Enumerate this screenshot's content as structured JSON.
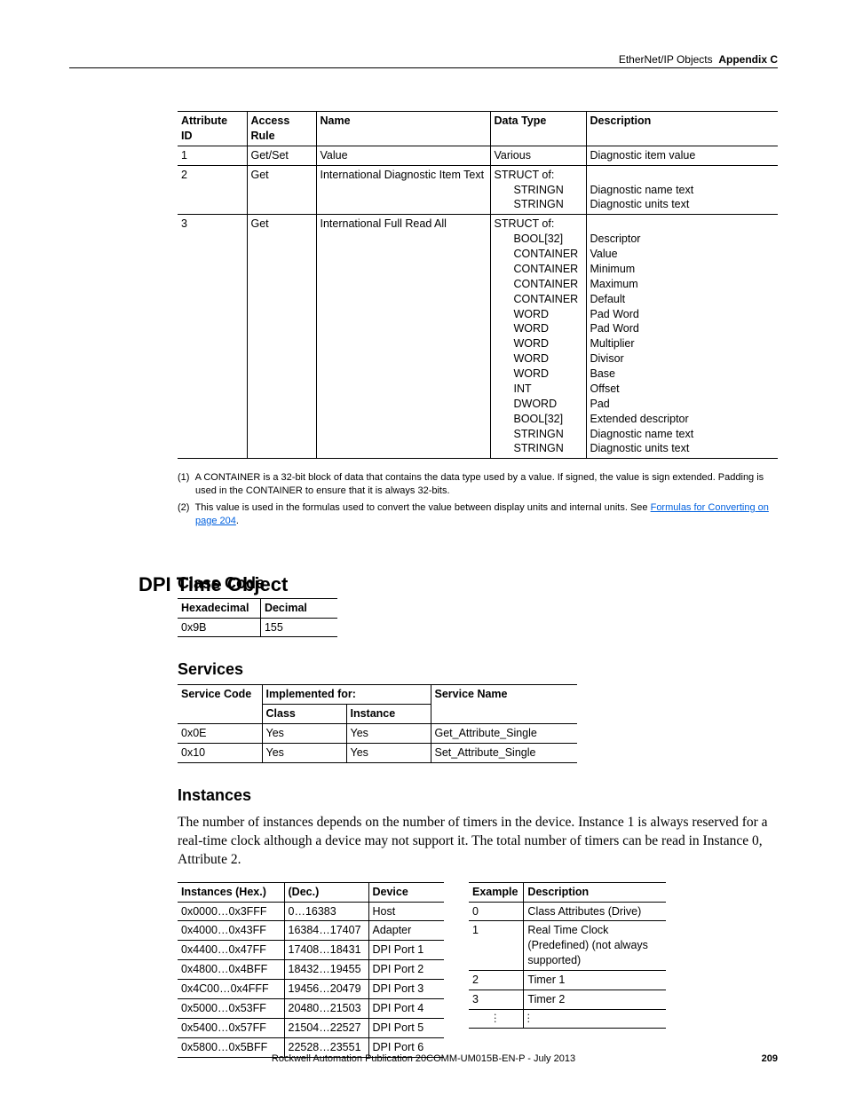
{
  "header": {
    "left": "EtherNet/IP Objects",
    "right": "Appendix C"
  },
  "table1": {
    "headers": [
      "Attribute ID",
      "Access Rule",
      "Name",
      "Data Type",
      "Description"
    ],
    "rows": [
      {
        "id": "1",
        "access": "Get/Set",
        "name": "Value",
        "dtype": "Various",
        "desc": "Diagnostic item value"
      },
      {
        "id": "2",
        "access": "Get",
        "name": "International Diagnostic Item Text",
        "dtype_lines": [
          "STRUCT of:",
          "STRINGN",
          "STRINGN"
        ],
        "desc_lines": [
          "",
          "Diagnostic name text",
          "Diagnostic units text"
        ]
      },
      {
        "id": "3",
        "access": "Get",
        "name": "International Full Read All",
        "dtype_lines": [
          "STRUCT of:",
          "BOOL[32]",
          "CONTAINER",
          "CONTAINER",
          "CONTAINER",
          "CONTAINER",
          "WORD",
          "WORD",
          "WORD",
          "WORD",
          "WORD",
          "INT",
          "DWORD",
          "BOOL[32]",
          "STRINGN",
          "STRINGN"
        ],
        "desc_lines": [
          "",
          "Descriptor",
          "Value",
          "Minimum",
          "Maximum",
          "Default",
          "Pad Word",
          "Pad Word",
          "Multiplier",
          "Divisor",
          "Base",
          "Offset",
          "Pad",
          "Extended descriptor",
          "Diagnostic name text",
          "Diagnostic units text"
        ]
      }
    ]
  },
  "footnotes": {
    "n1": "A CONTAINER is a 32-bit block of data that contains the data type used by a value. If signed, the value is sign extended. Padding is used in the CONTAINER to ensure that it is always 32-bits.",
    "n2_a": "This value is used in the formulas used to convert the value between display units and internal units. See ",
    "n2_link": "Formulas for Converting on page 204",
    "n2_b": "."
  },
  "section": {
    "title": "DPI Time Object"
  },
  "classcode": {
    "title": "Class Code",
    "headers": [
      "Hexadecimal",
      "Decimal"
    ],
    "row": [
      "0x9B",
      "155"
    ]
  },
  "services": {
    "title": "Services",
    "headers": {
      "code": "Service Code",
      "impl": "Implemented for:",
      "name": "Service Name",
      "class": "Class",
      "instance": "Instance"
    },
    "rows": [
      {
        "code": "0x0E",
        "class": "Yes",
        "instance": "Yes",
        "name": "Get_Attribute_Single"
      },
      {
        "code": "0x10",
        "class": "Yes",
        "instance": "Yes",
        "name": "Set_Attribute_Single"
      }
    ]
  },
  "instances": {
    "title": "Instances",
    "intro": "The number of instances depends on the number of timers in the device. Instance 1 is always reserved for a real-time clock although a device may not support it. The total number of timers can be read in Instance 0, Attribute 2.",
    "left": {
      "headers": [
        "Instances (Hex.)",
        "(Dec.)",
        "Device"
      ],
      "rows": [
        [
          "0x0000…0x3FFF",
          "0…16383",
          "Host"
        ],
        [
          "0x4000…0x43FF",
          "16384…17407",
          "Adapter"
        ],
        [
          "0x4400…0x47FF",
          "17408…18431",
          "DPI Port 1"
        ],
        [
          "0x4800…0x4BFF",
          "18432…19455",
          "DPI Port 2"
        ],
        [
          "0x4C00…0x4FFF",
          "19456…20479",
          "DPI Port 3"
        ],
        [
          "0x5000…0x53FF",
          "20480…21503",
          "DPI Port 4"
        ],
        [
          "0x5400…0x57FF",
          "21504…22527",
          "DPI Port 5"
        ],
        [
          "0x5800…0x5BFF",
          "22528…23551",
          "DPI Port 6"
        ]
      ]
    },
    "right": {
      "headers": [
        "Example",
        "Description"
      ],
      "rows": [
        [
          "0",
          "Class Attributes (Drive)"
        ],
        [
          "1",
          "Real Time Clock (Predefined) (not always supported)"
        ],
        [
          "2",
          "Timer 1"
        ],
        [
          "3",
          "Timer 2"
        ],
        [
          "⋮",
          "⋮"
        ]
      ]
    }
  },
  "footer": {
    "pub": "Rockwell Automation Publication  20COMM-UM015B-EN-P - July 2013",
    "page": "209"
  }
}
